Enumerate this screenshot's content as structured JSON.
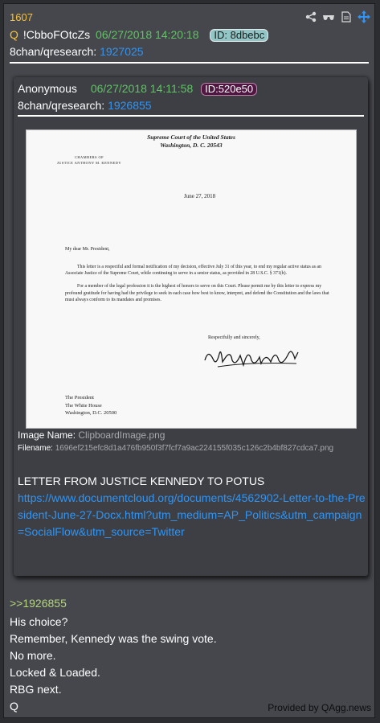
{
  "post": {
    "number": "1607",
    "q_marker": "Q",
    "tripcode": "!CbboFOtcZs",
    "datetime": "06/27/2018 14:20:18",
    "id_label": "ID: 8dbebc",
    "board": "8chan/qresearch:",
    "board_post": "1927025"
  },
  "toolbar": {
    "icons": [
      "share-icon",
      "glasses-icon",
      "document-icon",
      "move-icon"
    ]
  },
  "quoted": {
    "author": "Anonymous",
    "datetime": "06/27/2018 14:11:58",
    "id_label": "ID:520e50",
    "board": "8chan/qresearch:",
    "board_post": "1926855",
    "image_name_label": "Image Name:",
    "image_name": "ClipboardImage.png",
    "filename_label": "Filename:",
    "filename": "1696ef215efc8d1a476fb950f3f7fcf7a9ac224155f035c126c2b4bf827cdca7.png",
    "text": "LETTER FROM JUSTICE KENNEDY TO POTUS",
    "url": "https://www.documentcloud.org/documents/4562902-Letter-to-the-President-June-27-Docx.html?utm_medium=AP_Politics&utm_campaign=SocialFlow&utm_source=Twitter"
  },
  "letter": {
    "court_line1": "Supreme Court of the United States",
    "court_line2": "Washington, D. C. 20543",
    "chambers1": "CHAMBERS OF",
    "chambers2": "JUSTICE ANTHONY M. KENNEDY",
    "date": "June 27, 2018",
    "greeting": "My dear Mr. President,",
    "para1": "This letter is a respectful and formal notification of my decision, effective July 31 of this year, to end my regular active status as an Associate Justice of the Supreme Court, while continuing to serve in a senior status, as provided in 28 U.S.C. § 371(b).",
    "para2": "For a member of the legal profession it is the highest of honors to serve on this Court. Please permit me by this letter to express my profound gratitude for having had the privilege to seek in each case how best to know, interpret, and defend the Constitution and the laws that must always conform to its mandates and promises.",
    "closing": "Respectfully and sincerely,",
    "addr1": "The President",
    "addr2": "The White House",
    "addr3": "Washington, D.C. 20500"
  },
  "body": {
    "reply_link": ">>1926855",
    "lines": [
      "His choice?",
      "Remember, Kennedy was the swing vote.",
      "No more.",
      "Locked & Loaded.",
      "RBG next.",
      "Q"
    ]
  },
  "footer": {
    "provided_by": "Provided by QAgg.news"
  },
  "colors": {
    "post_number": "#f7c23b",
    "date": "#62c265",
    "link": "#2f94f4",
    "greentext": "#b5d67c"
  }
}
